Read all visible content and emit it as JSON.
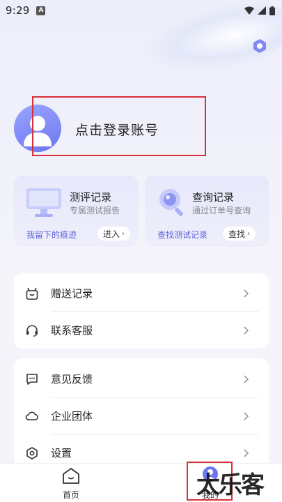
{
  "status_bar": {
    "time": "9:29",
    "badge": "A"
  },
  "profile": {
    "login_label": "点击登录账号"
  },
  "cards": [
    {
      "title": "测评记录",
      "subtitle": "专属测试报告",
      "footer": "我留下的痕迹",
      "button": "进入"
    },
    {
      "title": "查询记录",
      "subtitle": "通过订单号查询",
      "footer": "查找测试记录",
      "button": "查找"
    }
  ],
  "menu_group_1": [
    {
      "label": "赠送记录",
      "icon": "gift-icon"
    },
    {
      "label": "联系客服",
      "icon": "headset-icon"
    }
  ],
  "menu_group_2": [
    {
      "label": "意见反馈",
      "icon": "feedback-icon"
    },
    {
      "label": "企业团体",
      "icon": "cloud-icon"
    },
    {
      "label": "设置",
      "icon": "settings-icon"
    }
  ],
  "tabbar": {
    "home": "首页",
    "mine": "我的"
  },
  "watermark": "太乐客",
  "colors": {
    "accent": "#6c77f0",
    "highlight_box": "#d8303a",
    "background": "#f4f4fa"
  }
}
